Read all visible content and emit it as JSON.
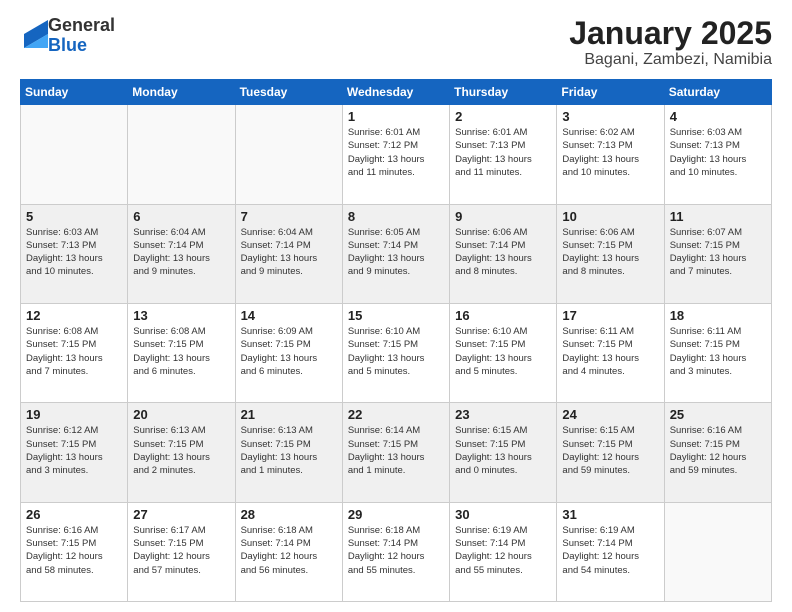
{
  "logo": {
    "general": "General",
    "blue": "Blue"
  },
  "title": "January 2025",
  "location": "Bagani, Zambezi, Namibia",
  "headers": [
    "Sunday",
    "Monday",
    "Tuesday",
    "Wednesday",
    "Thursday",
    "Friday",
    "Saturday"
  ],
  "weeks": [
    [
      {
        "day": "",
        "info": ""
      },
      {
        "day": "",
        "info": ""
      },
      {
        "day": "",
        "info": ""
      },
      {
        "day": "1",
        "info": "Sunrise: 6:01 AM\nSunset: 7:12 PM\nDaylight: 13 hours\nand 11 minutes."
      },
      {
        "day": "2",
        "info": "Sunrise: 6:01 AM\nSunset: 7:13 PM\nDaylight: 13 hours\nand 11 minutes."
      },
      {
        "day": "3",
        "info": "Sunrise: 6:02 AM\nSunset: 7:13 PM\nDaylight: 13 hours\nand 10 minutes."
      },
      {
        "day": "4",
        "info": "Sunrise: 6:03 AM\nSunset: 7:13 PM\nDaylight: 13 hours\nand 10 minutes."
      }
    ],
    [
      {
        "day": "5",
        "info": "Sunrise: 6:03 AM\nSunset: 7:13 PM\nDaylight: 13 hours\nand 10 minutes."
      },
      {
        "day": "6",
        "info": "Sunrise: 6:04 AM\nSunset: 7:14 PM\nDaylight: 13 hours\nand 9 minutes."
      },
      {
        "day": "7",
        "info": "Sunrise: 6:04 AM\nSunset: 7:14 PM\nDaylight: 13 hours\nand 9 minutes."
      },
      {
        "day": "8",
        "info": "Sunrise: 6:05 AM\nSunset: 7:14 PM\nDaylight: 13 hours\nand 9 minutes."
      },
      {
        "day": "9",
        "info": "Sunrise: 6:06 AM\nSunset: 7:14 PM\nDaylight: 13 hours\nand 8 minutes."
      },
      {
        "day": "10",
        "info": "Sunrise: 6:06 AM\nSunset: 7:15 PM\nDaylight: 13 hours\nand 8 minutes."
      },
      {
        "day": "11",
        "info": "Sunrise: 6:07 AM\nSunset: 7:15 PM\nDaylight: 13 hours\nand 7 minutes."
      }
    ],
    [
      {
        "day": "12",
        "info": "Sunrise: 6:08 AM\nSunset: 7:15 PM\nDaylight: 13 hours\nand 7 minutes."
      },
      {
        "day": "13",
        "info": "Sunrise: 6:08 AM\nSunset: 7:15 PM\nDaylight: 13 hours\nand 6 minutes."
      },
      {
        "day": "14",
        "info": "Sunrise: 6:09 AM\nSunset: 7:15 PM\nDaylight: 13 hours\nand 6 minutes."
      },
      {
        "day": "15",
        "info": "Sunrise: 6:10 AM\nSunset: 7:15 PM\nDaylight: 13 hours\nand 5 minutes."
      },
      {
        "day": "16",
        "info": "Sunrise: 6:10 AM\nSunset: 7:15 PM\nDaylight: 13 hours\nand 5 minutes."
      },
      {
        "day": "17",
        "info": "Sunrise: 6:11 AM\nSunset: 7:15 PM\nDaylight: 13 hours\nand 4 minutes."
      },
      {
        "day": "18",
        "info": "Sunrise: 6:11 AM\nSunset: 7:15 PM\nDaylight: 13 hours\nand 3 minutes."
      }
    ],
    [
      {
        "day": "19",
        "info": "Sunrise: 6:12 AM\nSunset: 7:15 PM\nDaylight: 13 hours\nand 3 minutes."
      },
      {
        "day": "20",
        "info": "Sunrise: 6:13 AM\nSunset: 7:15 PM\nDaylight: 13 hours\nand 2 minutes."
      },
      {
        "day": "21",
        "info": "Sunrise: 6:13 AM\nSunset: 7:15 PM\nDaylight: 13 hours\nand 1 minutes."
      },
      {
        "day": "22",
        "info": "Sunrise: 6:14 AM\nSunset: 7:15 PM\nDaylight: 13 hours\nand 1 minute."
      },
      {
        "day": "23",
        "info": "Sunrise: 6:15 AM\nSunset: 7:15 PM\nDaylight: 13 hours\nand 0 minutes."
      },
      {
        "day": "24",
        "info": "Sunrise: 6:15 AM\nSunset: 7:15 PM\nDaylight: 12 hours\nand 59 minutes."
      },
      {
        "day": "25",
        "info": "Sunrise: 6:16 AM\nSunset: 7:15 PM\nDaylight: 12 hours\nand 59 minutes."
      }
    ],
    [
      {
        "day": "26",
        "info": "Sunrise: 6:16 AM\nSunset: 7:15 PM\nDaylight: 12 hours\nand 58 minutes."
      },
      {
        "day": "27",
        "info": "Sunrise: 6:17 AM\nSunset: 7:15 PM\nDaylight: 12 hours\nand 57 minutes."
      },
      {
        "day": "28",
        "info": "Sunrise: 6:18 AM\nSunset: 7:14 PM\nDaylight: 12 hours\nand 56 minutes."
      },
      {
        "day": "29",
        "info": "Sunrise: 6:18 AM\nSunset: 7:14 PM\nDaylight: 12 hours\nand 55 minutes."
      },
      {
        "day": "30",
        "info": "Sunrise: 6:19 AM\nSunset: 7:14 PM\nDaylight: 12 hours\nand 55 minutes."
      },
      {
        "day": "31",
        "info": "Sunrise: 6:19 AM\nSunset: 7:14 PM\nDaylight: 12 hours\nand 54 minutes."
      },
      {
        "day": "",
        "info": ""
      }
    ]
  ]
}
